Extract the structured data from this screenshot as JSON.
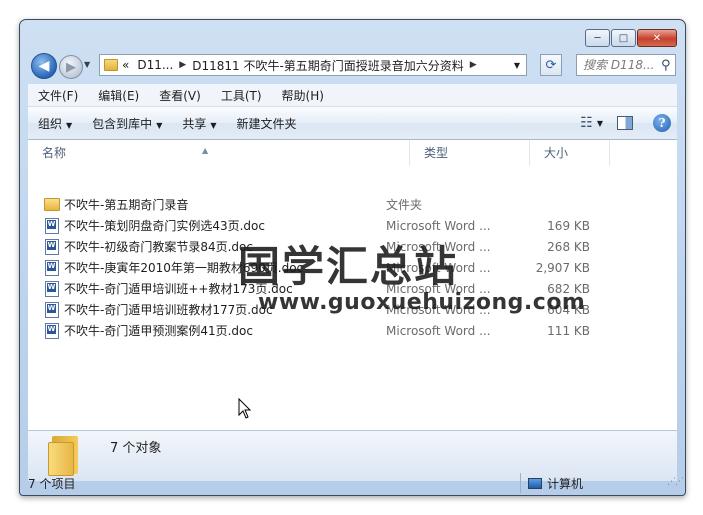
{
  "titlebar": {
    "minimize": "─",
    "maximize": "□",
    "close": "✕"
  },
  "address": {
    "chevron": "«",
    "crumbs": [
      "D11...",
      "D11811 不吹牛-第五期奇门面授班录音加六分资料"
    ],
    "search_placeholder": "搜索 D118..."
  },
  "menu": [
    "文件(F)",
    "编辑(E)",
    "查看(V)",
    "工具(T)",
    "帮助(H)"
  ],
  "commands": {
    "organize": "组织",
    "include_library": "包含到库中",
    "share": "共享",
    "new_folder": "新建文件夹"
  },
  "columns": {
    "name": "名称",
    "type": "类型",
    "size": "大小"
  },
  "files": [
    {
      "name": "不吹牛-第五期奇门录音",
      "type": "文件夹",
      "size": "",
      "icon": "folder-icon"
    },
    {
      "name": "不吹牛-策划阴盘奇门实例选43页.doc",
      "type": "Microsoft Word ...",
      "size": "169 KB",
      "icon": "word-doc-icon"
    },
    {
      "name": "不吹牛-初级奇门教案节录84页.doc",
      "type": "Microsoft Word ...",
      "size": "268 KB",
      "icon": "word-doc-icon"
    },
    {
      "name": "不吹牛-庚寅年2010年第一期教材690页.doc",
      "type": "Microsoft Word ...",
      "size": "2,907 KB",
      "icon": "word-doc-icon"
    },
    {
      "name": "不吹牛-奇门遁甲培训班++教材173页.doc",
      "type": "Microsoft Word ...",
      "size": "682 KB",
      "icon": "word-doc-icon"
    },
    {
      "name": "不吹牛-奇门遁甲培训班教材177页.doc",
      "type": "Microsoft Word ...",
      "size": "604 KB",
      "icon": "word-doc-icon"
    },
    {
      "name": "不吹牛-奇门遁甲预测案例41页.doc",
      "type": "Microsoft Word ...",
      "size": "111 KB",
      "icon": "word-doc-icon"
    }
  ],
  "watermark": {
    "title": "国学汇总站",
    "url": "www.guoxuehuizong.com"
  },
  "details": {
    "count": "7 个对象"
  },
  "statusbar": {
    "items": "7 个项目",
    "location": "计算机"
  }
}
